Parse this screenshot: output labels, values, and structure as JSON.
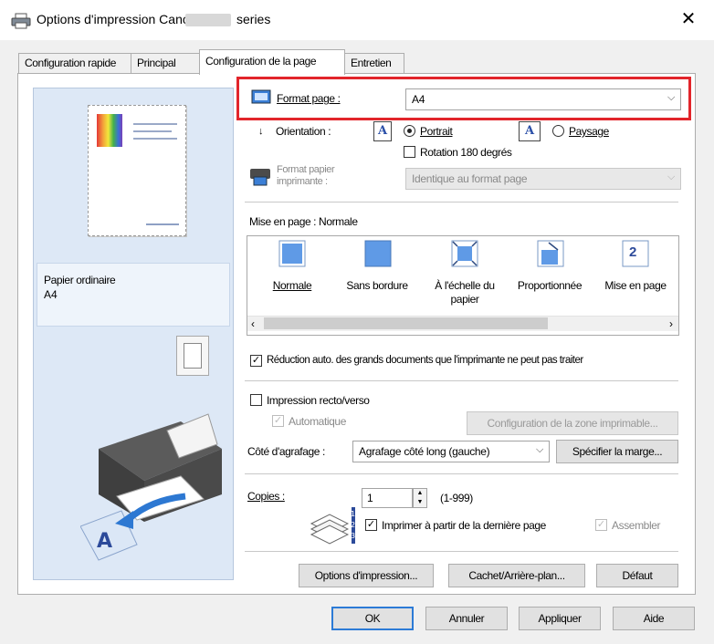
{
  "window": {
    "title": "Options d'impression Canon",
    "title_suffix": "series",
    "close_label": "✕"
  },
  "tabs": [
    {
      "label": "Configuration rapide"
    },
    {
      "label": "Principal"
    },
    {
      "label": "Configuration de la page"
    },
    {
      "label": "Entretien"
    }
  ],
  "preview": {
    "paper_type": "Papier ordinaire",
    "paper_size": "A4"
  },
  "page_setup": {
    "format_label": "Format page :",
    "format_value": "A4",
    "orientation_label": "Orientation :",
    "portrait_label": "Portrait",
    "landscape_label": "Paysage",
    "rotation_label": "Rotation 180 degrés",
    "printer_paper_label_1": "Format papier",
    "printer_paper_label_2": "imprimante :",
    "printer_paper_value": "Identique au format page",
    "layout_heading": "Mise en page : Normale",
    "layout_options": [
      {
        "label": "Normale"
      },
      {
        "label": "Sans bordure"
      },
      {
        "label": "À l'échelle du papier"
      },
      {
        "label": "Proportionnée"
      },
      {
        "label": "Mise en page"
      }
    ],
    "layout_icon_number": "2",
    "reduce_label": "Réduction auto. des grands documents que l'imprimante ne peut pas traiter",
    "duplex_label": "Impression recto/verso",
    "auto_label": "Automatique",
    "print_area_button": "Configuration de la zone imprimable...",
    "stapling_label": "Côté d'agrafage :",
    "stapling_value": "Agrafage côté long (gauche)",
    "margin_button": "Spécifier la marge...",
    "copies_label": "Copies :",
    "copies_value": "1",
    "copies_range": "(1-999)",
    "last_page_label": "Imprimer à partir de la dernière page",
    "collate_label": "Assembler",
    "print_options_button": "Options d'impression...",
    "stamp_button": "Cachet/Arrière-plan...",
    "default_button": "Défaut"
  },
  "footer": {
    "ok": "OK",
    "cancel": "Annuler",
    "apply": "Appliquer",
    "help": "Aide"
  },
  "colors": {
    "highlight_border": "#e2252b",
    "preview_bg": "#dde8f6",
    "icon_blue": "#3a7fd8"
  }
}
